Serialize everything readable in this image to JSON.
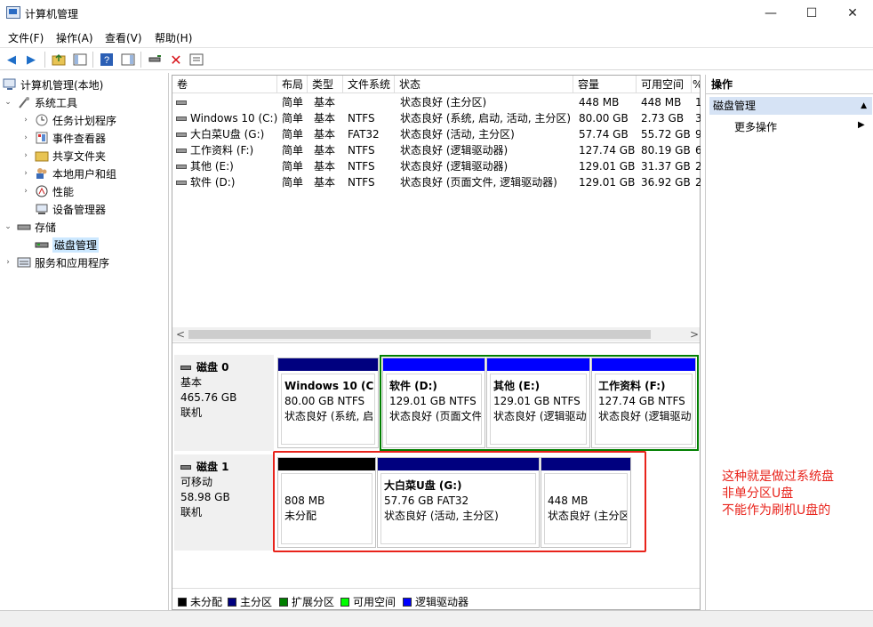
{
  "window": {
    "title": "计算机管理",
    "min_glyph": "—",
    "max_glyph": "☐",
    "close_glyph": "✕"
  },
  "menu": [
    "文件(F)",
    "操作(A)",
    "查看(V)",
    "帮助(H)"
  ],
  "tree": {
    "root": "计算机管理(本地)",
    "system_tools": "系统工具",
    "task_scheduler": "任务计划程序",
    "event_viewer": "事件查看器",
    "shared_folders": "共享文件夹",
    "local_users": "本地用户和组",
    "performance": "性能",
    "device_manager": "设备管理器",
    "storage": "存储",
    "disk_management": "磁盘管理",
    "services": "服务和应用程序"
  },
  "volume_headers": [
    "卷",
    "布局",
    "类型",
    "文件系统",
    "状态",
    "容量",
    "可用空间",
    "%"
  ],
  "volumes": [
    {
      "name": "",
      "layout": "简单",
      "type": "基本",
      "fs": "",
      "status": "状态良好 (主分区)",
      "capacity": "448 MB",
      "free": "448 MB",
      "pct": "1"
    },
    {
      "name": "Windows 10 (C:)",
      "layout": "简单",
      "type": "基本",
      "fs": "NTFS",
      "status": "状态良好 (系统, 启动, 活动, 主分区)",
      "capacity": "80.00 GB",
      "free": "2.73 GB",
      "pct": "3"
    },
    {
      "name": "大白菜U盘 (G:)",
      "layout": "简单",
      "type": "基本",
      "fs": "FAT32",
      "status": "状态良好 (活动, 主分区)",
      "capacity": "57.74 GB",
      "free": "55.72 GB",
      "pct": "9"
    },
    {
      "name": "工作资料 (F:)",
      "layout": "简单",
      "type": "基本",
      "fs": "NTFS",
      "status": "状态良好 (逻辑驱动器)",
      "capacity": "127.74 GB",
      "free": "80.19 GB",
      "pct": "6"
    },
    {
      "name": "其他 (E:)",
      "layout": "简单",
      "type": "基本",
      "fs": "NTFS",
      "status": "状态良好 (逻辑驱动器)",
      "capacity": "129.01 GB",
      "free": "31.37 GB",
      "pct": "2"
    },
    {
      "name": "软件 (D:)",
      "layout": "简单",
      "type": "基本",
      "fs": "NTFS",
      "status": "状态良好 (页面文件, 逻辑驱动器)",
      "capacity": "129.01 GB",
      "free": "36.92 GB",
      "pct": "2"
    }
  ],
  "scroll": {
    "left": "<",
    "right": ">"
  },
  "disk0": {
    "name": "磁盘 0",
    "type": "基本",
    "size": "465.76 GB",
    "state": "联机",
    "parts": [
      {
        "name": "Windows 10  (C:",
        "size": "80.00 GB NTFS",
        "status": "状态良好 (系统, 启"
      },
      {
        "name": "软件  (D:)",
        "size": "129.01 GB NTFS",
        "status": "状态良好 (页面文件"
      },
      {
        "name": "其他   (E:)",
        "size": "129.01 GB NTFS",
        "status": "状态良好 (逻辑驱动"
      },
      {
        "name": "工作资料  (F:)",
        "size": "127.74 GB NTFS",
        "status": "状态良好 (逻辑驱动"
      }
    ]
  },
  "disk1": {
    "name": "磁盘 1",
    "type": "可移动",
    "size": "58.98 GB",
    "state": "联机",
    "parts": [
      {
        "name": "",
        "size": "808 MB",
        "status": "未分配"
      },
      {
        "name": "大白菜U盘  (G:)",
        "size": "57.76 GB FAT32",
        "status": "状态良好 (活动, 主分区)"
      },
      {
        "name": "",
        "size": "448 MB",
        "status": "状态良好 (主分区"
      }
    ]
  },
  "legend": [
    "未分配",
    "主分区",
    "扩展分区",
    "可用空间",
    "逻辑驱动器"
  ],
  "colors": {
    "unallocated": "#000000",
    "primary": "#00007f",
    "extended": "#007f00",
    "free": "#00ff00",
    "logical": "#0000ff",
    "annotation": "#e8231b"
  },
  "actions": {
    "title": "操作",
    "section": "磁盘管理",
    "more": "更多操作"
  },
  "annotation": [
    "这种就是做过系统盘",
    "非单分区U盘",
    "不能作为刷机U盘的"
  ]
}
